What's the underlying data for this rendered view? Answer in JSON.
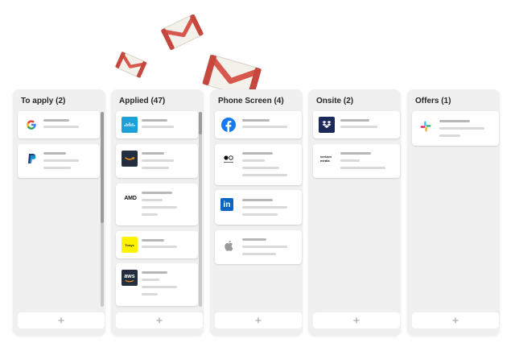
{
  "board": {
    "columns": [
      {
        "title": "To apply (2)",
        "add_label": "+",
        "cards": [
          {
            "logo": "google-logo"
          },
          {
            "logo": "paypal-logo"
          }
        ]
      },
      {
        "title": "Applied (47)",
        "add_label": "+",
        "cards": [
          {
            "logo": "cisco-logo"
          },
          {
            "logo": "amazon-logo"
          },
          {
            "logo": "amd-logo",
            "logo_text": "AMD"
          },
          {
            "logo": "yellow-logo",
            "logo_text": "Tonys"
          },
          {
            "logo": "aws-logo",
            "logo_text": "aws"
          }
        ]
      },
      {
        "title": "Phone Screen (4)",
        "add_label": "+",
        "cards": [
          {
            "logo": "facebook-logo"
          },
          {
            "logo": "quartet-logo"
          },
          {
            "logo": "linkedin-logo",
            "logo_text": "in"
          },
          {
            "logo": "apple-logo"
          }
        ]
      },
      {
        "title": "Onsite (2)",
        "add_label": "+",
        "cards": [
          {
            "logo": "dropbox-logo"
          },
          {
            "logo": "verizon-media-logo",
            "logo_text": "verizon media"
          }
        ]
      },
      {
        "title": "Offers (1)",
        "add_label": "+",
        "cards": [
          {
            "logo": "slack-logo"
          }
        ]
      }
    ]
  },
  "colors": {
    "gmail_red": "#d8574c",
    "facebook_blue": "#1877f2",
    "linkedin_blue": "#0a66c2",
    "dropbox_navy": "#1c2a5a",
    "cisco_blue": "#1ba0d7",
    "amazon_dark": "#232f3e",
    "yellow": "#fff200"
  }
}
